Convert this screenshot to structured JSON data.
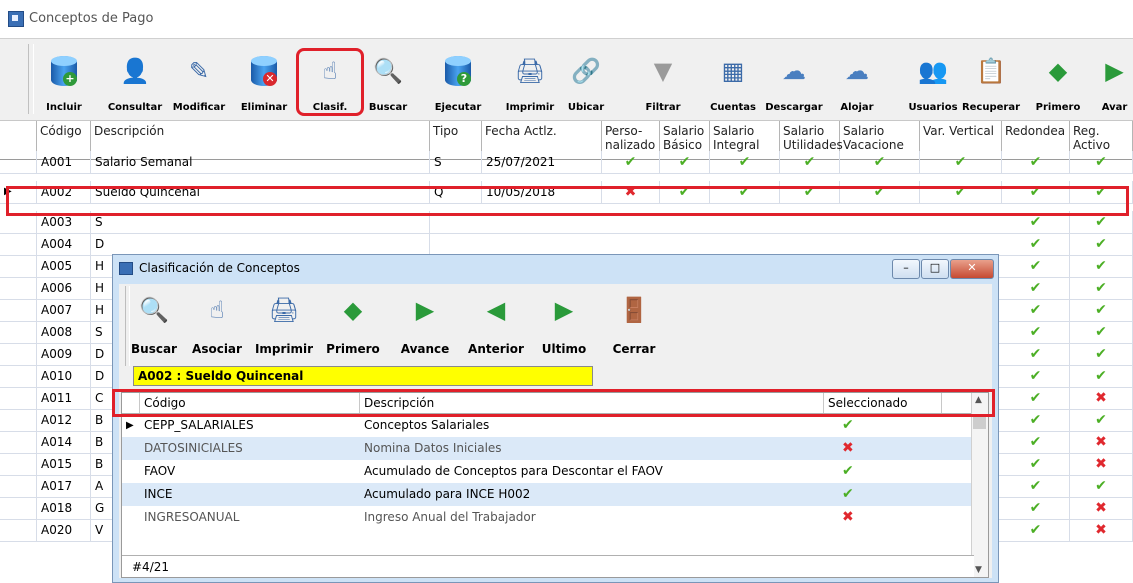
{
  "window": {
    "title": "Conceptos de Pago"
  },
  "toolbar": [
    {
      "label": "Incluir",
      "icon": "add-database-icon"
    },
    {
      "label": "Consultar",
      "icon": "consult-icon"
    },
    {
      "label": "Modificar",
      "icon": "edit-icon"
    },
    {
      "label": "Eliminar",
      "icon": "delete-database-icon"
    },
    {
      "label": "Clasif.",
      "icon": "hand-pointer-icon"
    },
    {
      "label": "Buscar",
      "icon": "search-icon"
    },
    {
      "label": "Ejecutar",
      "icon": "help-database-icon"
    },
    {
      "label": "Imprimir",
      "icon": "printer-icon"
    },
    {
      "label": "Ubicar",
      "icon": "link-icon"
    },
    {
      "label": "Filtrar",
      "icon": "filter-icon"
    },
    {
      "label": "Cuentas",
      "icon": "accounts-icon"
    },
    {
      "label": "Descargar",
      "icon": "cloud-download-icon"
    },
    {
      "label": "Alojar",
      "icon": "cloud-icon"
    },
    {
      "label": "Usuarios",
      "icon": "users-icon"
    },
    {
      "label": "Recuperar",
      "icon": "recover-icon"
    },
    {
      "label": "Primero",
      "icon": "first-record-icon"
    },
    {
      "label": "Avar",
      "icon": "next-record-icon"
    }
  ],
  "grid": {
    "headers": {
      "codigo": "Código",
      "descripcion": "Descripción",
      "tipo": "Tipo",
      "fecha": "Fecha Actlz.",
      "perso": "Perso- nalizado",
      "sb": "Salario Básico",
      "si": "Salario Integral",
      "su": "Salario Utilidades",
      "sv": "Salario Vacacione",
      "vv": "Var. Vertical",
      "red": "Redondea",
      "reg": "Reg. Activo"
    },
    "rows": [
      {
        "code": "A001",
        "desc": "Salario Semanal",
        "tipo": "S",
        "fecha": "25/07/2021",
        "perso": "check",
        "reg": "check"
      },
      {
        "code": "A002",
        "desc": "Sueldo Quincenal",
        "tipo": "Q",
        "fecha": "10/05/2018",
        "perso": "cross",
        "reg": "check"
      },
      {
        "code": "A003",
        "desc": "S",
        "reg": "check"
      },
      {
        "code": "A004",
        "desc": "D",
        "reg": "check"
      },
      {
        "code": "A005",
        "desc": "H",
        "reg": "check"
      },
      {
        "code": "A006",
        "desc": "H",
        "reg": "check"
      },
      {
        "code": "A007",
        "desc": "H",
        "reg": "check"
      },
      {
        "code": "A008",
        "desc": "S",
        "reg": "check"
      },
      {
        "code": "A009",
        "desc": "D",
        "reg": "check"
      },
      {
        "code": "A010",
        "desc": "D",
        "reg": "check"
      },
      {
        "code": "A011",
        "desc": "C",
        "reg": "cross"
      },
      {
        "code": "A012",
        "desc": "B",
        "reg": "check"
      },
      {
        "code": "A014",
        "desc": "B",
        "reg": "cross"
      },
      {
        "code": "A015",
        "desc": "B",
        "reg": "cross"
      },
      {
        "code": "A017",
        "desc": "A",
        "reg": "check"
      },
      {
        "code": "A018",
        "desc": "G",
        "reg": "cross"
      },
      {
        "code": "A020",
        "desc": "V",
        "reg": "cross"
      }
    ]
  },
  "dialog": {
    "title": "Clasificación de Conceptos",
    "buttons": {
      "minimize": "–",
      "maximize": "□",
      "close": "✕"
    },
    "toolbar": [
      {
        "label": "Buscar",
        "icon": "search-icon"
      },
      {
        "label": "Asociar",
        "icon": "hand-pointer-icon"
      },
      {
        "label": "Imprimir",
        "icon": "printer-icon"
      },
      {
        "label": "Primero",
        "icon": "first-record-icon"
      },
      {
        "label": "Avance",
        "icon": "next-record-icon"
      },
      {
        "label": "Anterior",
        "icon": "previous-record-icon"
      },
      {
        "label": "Ultimo",
        "icon": "last-record-icon"
      },
      {
        "label": "Cerrar",
        "icon": "exit-door-icon"
      }
    ],
    "selected_concept": "A002 : Sueldo Quincenal",
    "headers": {
      "codigo": "Código",
      "descripcion": "Descripción",
      "seleccionado": "Seleccionado"
    },
    "rows": [
      {
        "code": "CEPP_SALARIALES",
        "desc": "Conceptos Salariales",
        "sel": "check"
      },
      {
        "code": "DATOSINICIALES",
        "desc": "Nomina Datos Iniciales",
        "sel": "cross"
      },
      {
        "code": "FAOV",
        "desc": "Acumulado de Conceptos para Descontar el FAOV",
        "sel": "check"
      },
      {
        "code": "INCE",
        "desc": "Acumulado para INCE H002",
        "sel": "check"
      },
      {
        "code": "INGRESOANUAL",
        "desc": "Ingreso Anual del Trabajador",
        "sel": "cross"
      }
    ],
    "footer": "#4/21"
  },
  "colors": {
    "accent": "#e0202a",
    "check": "#4caf25",
    "cross": "#e0282e",
    "highlight": "#ffff00",
    "dialog_frame": "#cde2f6"
  }
}
